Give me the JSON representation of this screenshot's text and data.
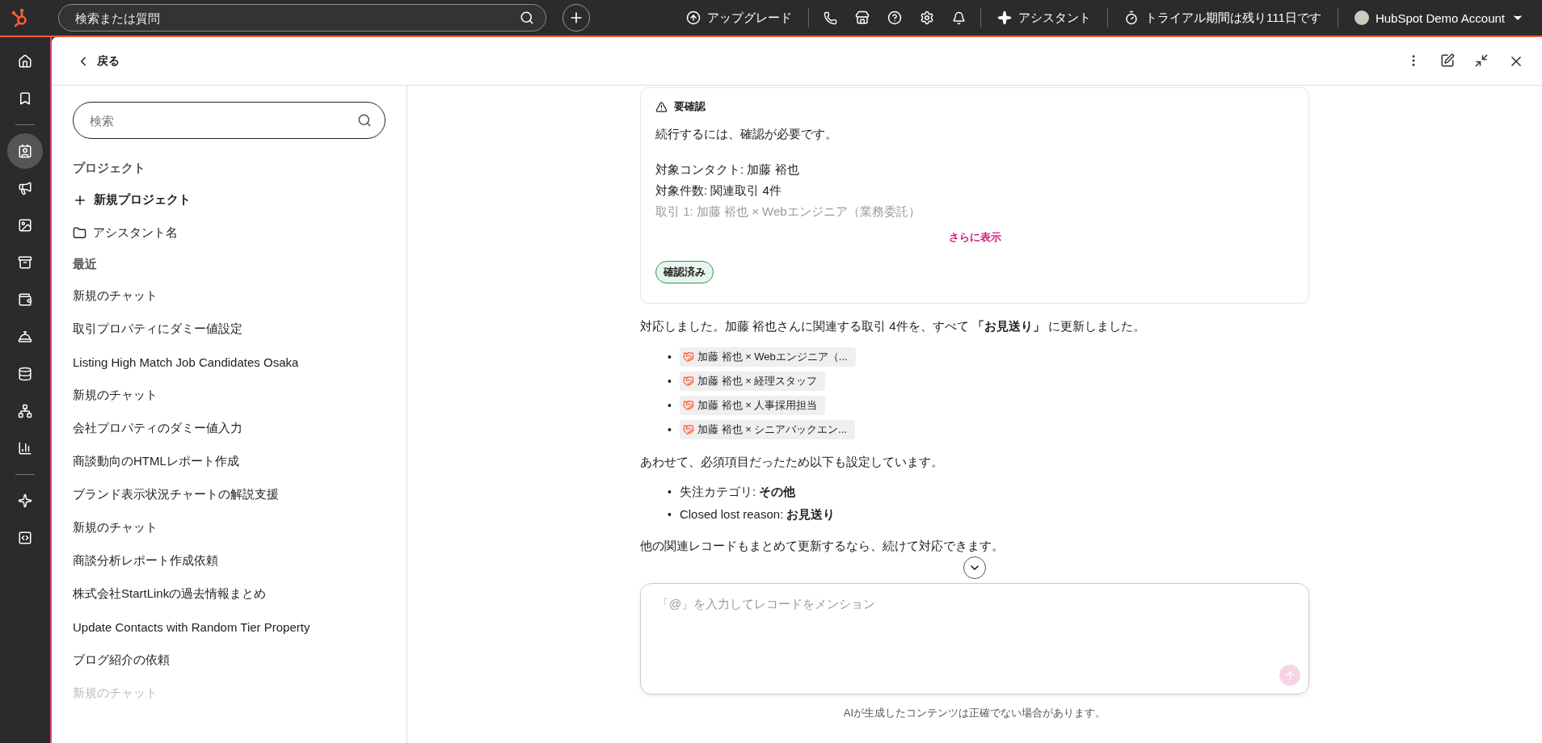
{
  "top_bar": {
    "search": {
      "placeholder": "検索または質問"
    },
    "upgrade": "アップグレード",
    "assistant": "アシスタント",
    "trial": "トライアル期間は残り111日です",
    "account": "HubSpot Demo Account"
  },
  "rail": [
    {
      "kind": "icon",
      "selected": false
    },
    {
      "kind": "icon",
      "selected": false
    },
    {
      "kind": "divider"
    },
    {
      "kind": "icon",
      "selected": true
    },
    {
      "kind": "icon",
      "selected": false
    },
    {
      "kind": "icon",
      "selected": false
    },
    {
      "kind": "icon",
      "selected": false
    },
    {
      "kind": "icon",
      "selected": false
    },
    {
      "kind": "icon",
      "selected": false
    },
    {
      "kind": "icon",
      "selected": false
    },
    {
      "kind": "icon",
      "selected": false
    },
    {
      "kind": "icon",
      "selected": false
    },
    {
      "kind": "divider"
    },
    {
      "kind": "icon",
      "selected": false
    },
    {
      "kind": "icon",
      "selected": false
    }
  ],
  "panel_header": {
    "back": "戻る"
  },
  "sidebar": {
    "search": {
      "placeholder": "検索"
    },
    "projects_heading": "プロジェクト",
    "new_project": "新規プロジェクト",
    "folders": [
      "アシスタント名"
    ],
    "recent_heading": "最近",
    "recent": [
      "新規のチャット",
      "取引プロパティにダミー値設定",
      "Listing High Match Job Candidates Osaka",
      "新規のチャット",
      "会社プロパティのダミー値入力",
      "商談動向のHTMLレポート作成",
      "ブランド表示状況チャートの解説支援",
      "新規のチャット",
      "商談分析レポート作成依頼",
      "株式会社StartLinkの過去情報まとめ",
      "Update Contacts with Random Tier Property",
      "ブログ紹介の依頼",
      "新規のチャット"
    ]
  },
  "chat": {
    "confirmation": {
      "title": "要確認",
      "message": "続行するには、確認が必要です。",
      "details": [
        "対象コンタクト: 加藤 裕也",
        "対象件数: 関連取引 4件",
        "取引 1: 加藤 裕也 × Webエンジニア（業務委託）"
      ],
      "show_more": "さらに表示",
      "status": "確認済み"
    },
    "reply": "対応しました。加藤 裕也さんに関連する取引 4件を、すべて **「お見送り」** に更新しました。",
    "deals": [
      "加藤 裕也 × Webエンジニア（...",
      "加藤 裕也 × 経理スタッフ",
      "加藤 裕也 × 人事採用担当",
      "加藤 裕也 × シニアバックエン..."
    ],
    "note": "あわせて、必須項目だったため以下も設定しています。",
    "fields": [
      "失注カテゴリ: **その他**",
      "Closed lost reason: **お見送り**"
    ],
    "closing": "他の関連レコードもまとめて更新するなら、続けて対応できます。",
    "bullet": "•"
  },
  "composer": {
    "placeholder": "「@」を入力してレコードをメンション"
  },
  "disclaimer": "AIが生成したコンテンツは正確でない場合があります。"
}
